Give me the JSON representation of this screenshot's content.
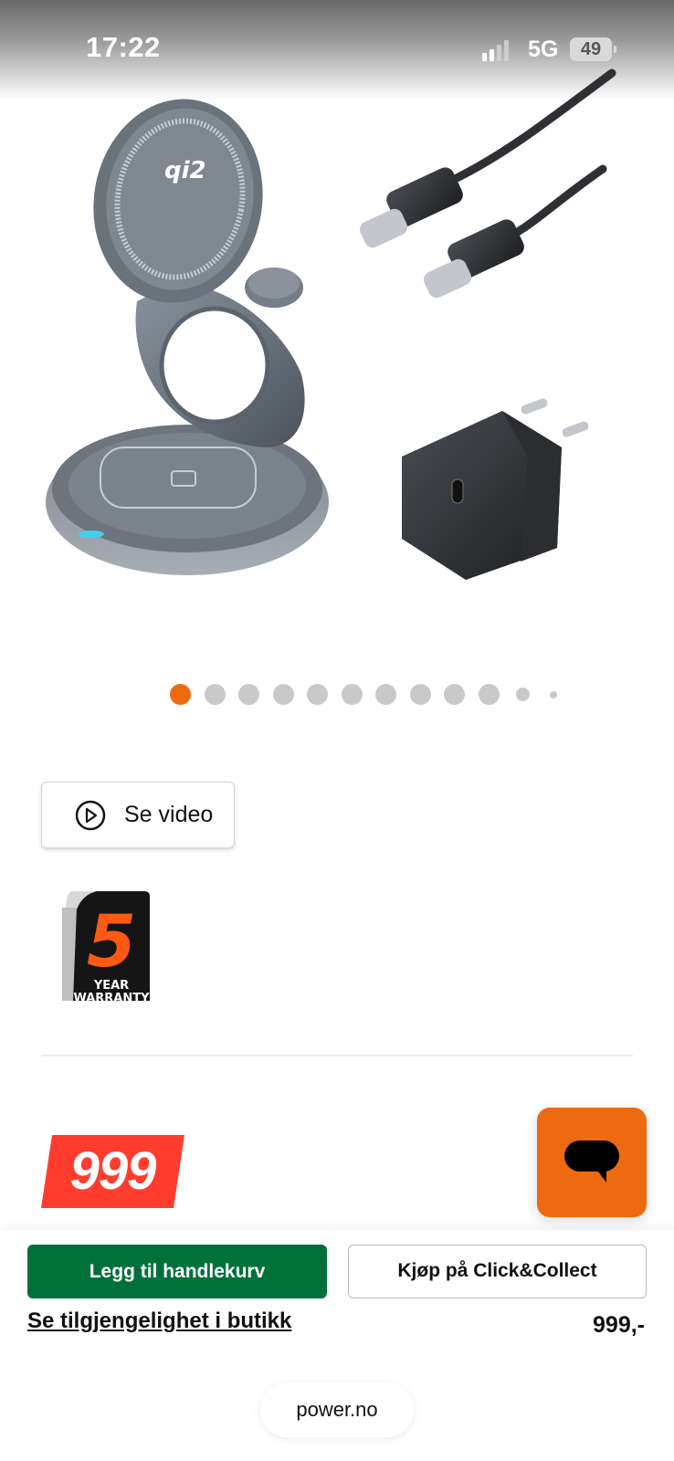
{
  "status_bar": {
    "time": "17:22",
    "network": "5G",
    "battery": "49"
  },
  "carousel": {
    "total_dots": 12,
    "active_index": 0,
    "accent_color": "#ee6a10"
  },
  "video_button": {
    "label": "Se video",
    "icon": "play-icon"
  },
  "warranty_badge": {
    "years": "5",
    "text": "YEAR",
    "text2": "WARRANTY"
  },
  "price": {
    "badge_value": "999",
    "small_price": "999,-",
    "badge_color": "#ff3c2e"
  },
  "actions": {
    "add_to_cart": "Legg til handlekurv",
    "click_collect": "Kjøp på Click&Collect",
    "availability_link": "Se tilgjengelighet i butikk",
    "add_to_cart_color": "#00703b"
  },
  "chat": {
    "icon": "chat-bubble-icon",
    "color": "#ee6a10"
  },
  "browser": {
    "url": "power.no"
  }
}
